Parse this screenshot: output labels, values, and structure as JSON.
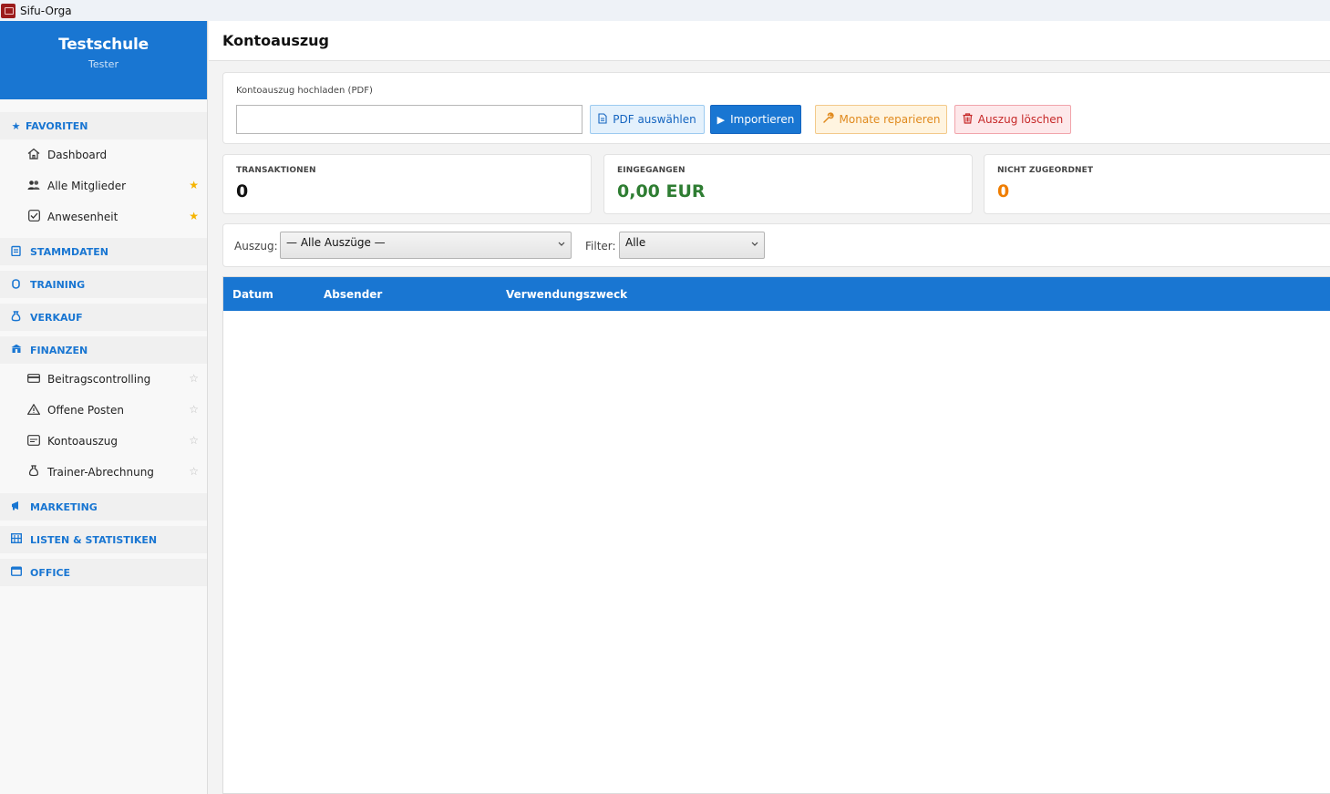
{
  "window": {
    "title": "Sifu-Orga"
  },
  "sidebar": {
    "brand": {
      "school": "Testschule",
      "user": "Tester"
    },
    "sections": {
      "favoriten": {
        "label": "FAVORITEN",
        "items": [
          {
            "label": "Dashboard",
            "icon": "house-icon",
            "star": ""
          },
          {
            "label": "Alle Mitglieder",
            "icon": "people-icon",
            "star": "★"
          },
          {
            "label": "Anwesenheit",
            "icon": "checkbox-icon",
            "star": "★"
          }
        ]
      },
      "stammdaten": {
        "label": "STAMMDATEN"
      },
      "training": {
        "label": "TRAINING"
      },
      "verkauf": {
        "label": "VERKAUF"
      },
      "finanzen": {
        "label": "FINANZEN",
        "items": [
          {
            "label": "Beitragscontrolling",
            "icon": "card-icon",
            "star": "☆"
          },
          {
            "label": "Offene Posten",
            "icon": "warning-icon",
            "star": "☆"
          },
          {
            "label": "Kontoauszug",
            "icon": "statement-icon",
            "star": "☆"
          },
          {
            "label": "Trainer-Abrechnung",
            "icon": "moneybag-icon",
            "star": "☆"
          }
        ]
      },
      "marketing": {
        "label": "MARKETING"
      },
      "listen": {
        "label": "LISTEN & STATISTIKEN"
      },
      "office": {
        "label": "OFFICE"
      }
    }
  },
  "page": {
    "title": "Kontoauszug"
  },
  "upload": {
    "label": "Kontoauszug hochladen (PDF)",
    "file_value": "",
    "buttons": {
      "pdf": "PDF auswählen",
      "import": "Importieren",
      "repair": "Monate reparieren",
      "delete": "Auszug löschen"
    }
  },
  "stats": [
    {
      "label": "TRANSAKTIONEN",
      "value": "0",
      "color": "#111111"
    },
    {
      "label": "EINGEGANGEN",
      "value": "0,00 EUR",
      "color": "#2e7d32"
    },
    {
      "label": "NICHT ZUGEORDNET",
      "value": "0",
      "color": "#ef7d00"
    }
  ],
  "filters": {
    "auszug_label": "Auszug:",
    "auszug_value": "— Alle Auszüge —",
    "filter_label": "Filter:",
    "filter_value": "Alle"
  },
  "table": {
    "columns": [
      "Datum",
      "Absender",
      "Verwendungszweck"
    ],
    "rows": []
  },
  "colors": {
    "accent": "#1976d2",
    "favorite_star": "#f5b400"
  }
}
